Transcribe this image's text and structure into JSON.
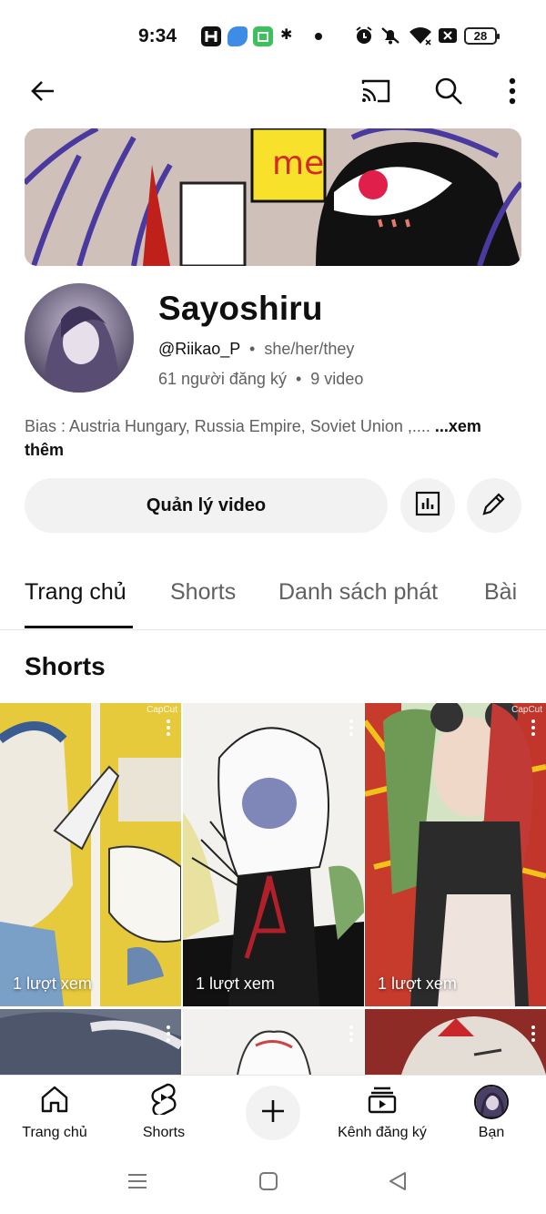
{
  "status_bar": {
    "time": "9:34",
    "battery": "28",
    "icons": [
      "h-app-icon",
      "blue-app-icon",
      "green-app-icon",
      "sparkle-icon",
      "alarm-icon",
      "mute-icon",
      "wifi-icon",
      "x-box-icon"
    ]
  },
  "top_bar": {
    "icons": [
      "back-arrow-icon",
      "cast-icon",
      "search-icon",
      "more-vert-icon"
    ]
  },
  "channel": {
    "name": "Sayoshiru",
    "handle": "@Riikao_P",
    "pronouns": "she/her/they",
    "separator": "•",
    "subscribers": "61 người đăng ký",
    "videos": "9 video",
    "bio": "Bias : Austria Hungary, Russia Empire, Soviet Union ,.... ",
    "bio_more": "...xem thêm"
  },
  "actions": {
    "manage_label": "Quản lý video",
    "analytics_icon": "analytics-icon",
    "edit_icon": "pencil-icon"
  },
  "tabs": [
    {
      "label": "Trang chủ",
      "active": true
    },
    {
      "label": "Shorts",
      "active": false
    },
    {
      "label": "Danh sách phát",
      "active": false
    },
    {
      "label": "Bài",
      "active": false
    }
  ],
  "shorts_section": {
    "title": "Shorts",
    "items": [
      {
        "views": "1 lượt xem",
        "watermark": "CapCut"
      },
      {
        "views": "1 lượt xem",
        "watermark": ""
      },
      {
        "views": "1 lượt xem",
        "watermark": "CapCut"
      }
    ]
  },
  "bottom_nav": [
    {
      "label": "Trang chủ",
      "icon": "home-icon"
    },
    {
      "label": "Shorts",
      "icon": "shorts-icon"
    },
    {
      "label": "",
      "icon": "plus-icon"
    },
    {
      "label": "Kênh đăng ký",
      "icon": "subscriptions-icon"
    },
    {
      "label": "Bạn",
      "icon": "avatar"
    }
  ],
  "colors": {
    "text": "#0f0f0f",
    "muted": "#606060",
    "chip_bg": "#f2f2f2"
  }
}
